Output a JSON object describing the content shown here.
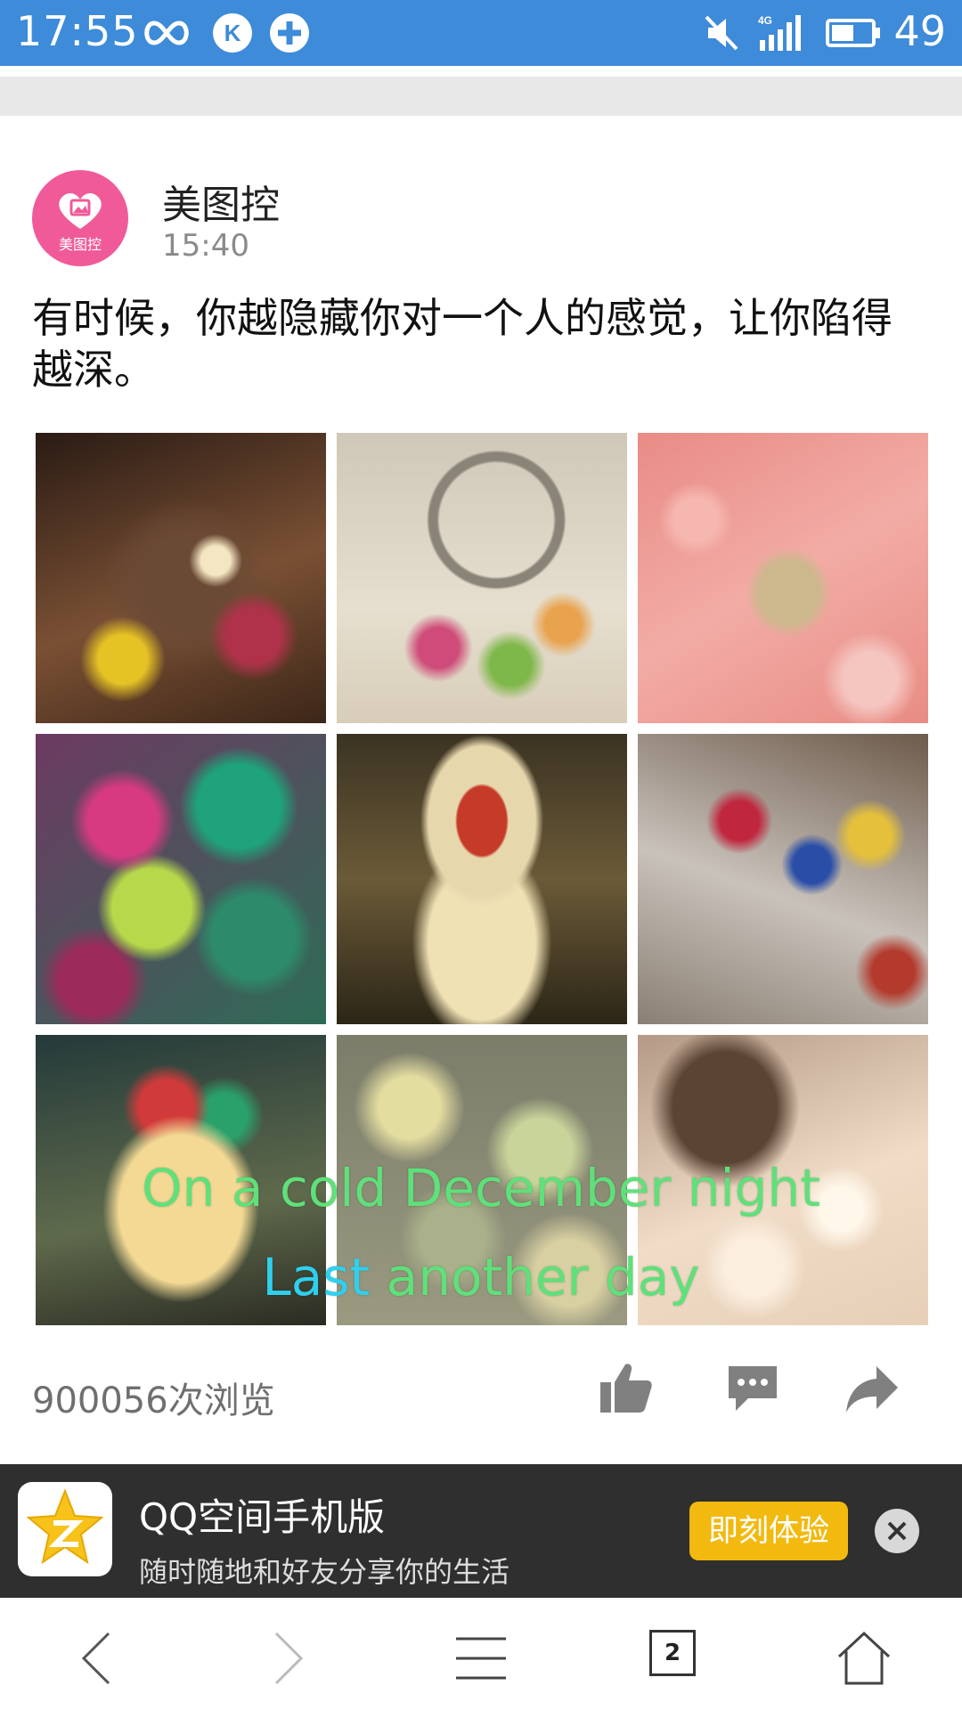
{
  "status_bar": {
    "time": "17:55",
    "battery": "49",
    "network": "4G",
    "icons": [
      "infinity-icon",
      "k-app-icon",
      "plus-app-icon",
      "mute-icon",
      "signal-icon",
      "battery-icon"
    ]
  },
  "post": {
    "author": "美图控",
    "avatar_label": "美图控",
    "time": "15:40",
    "text": "有时候，你越隐藏你对一个人的感觉，让你陷得越深。",
    "caption_line1": "On a cold December night",
    "caption_line2_part1": "Last",
    "caption_line2_part2": " another day",
    "views": "900056次浏览",
    "actions": [
      "like-icon",
      "comment-icon",
      "share-icon"
    ]
  },
  "banner": {
    "title": "QQ空间手机版",
    "subtitle": "随时随地和好友分享你的生活",
    "button": "即刻体验"
  },
  "navbar": {
    "tab_count": "2",
    "icons": [
      "back-icon",
      "forward-icon",
      "menu-icon",
      "tabs-icon",
      "home-icon"
    ]
  },
  "colors": {
    "status_bar": "#3d8bd9",
    "avatar": "#f05a99",
    "banner_button": "#f2b90f",
    "caption_green": "#5fe07a",
    "caption_cyan": "#2fd0ee"
  }
}
